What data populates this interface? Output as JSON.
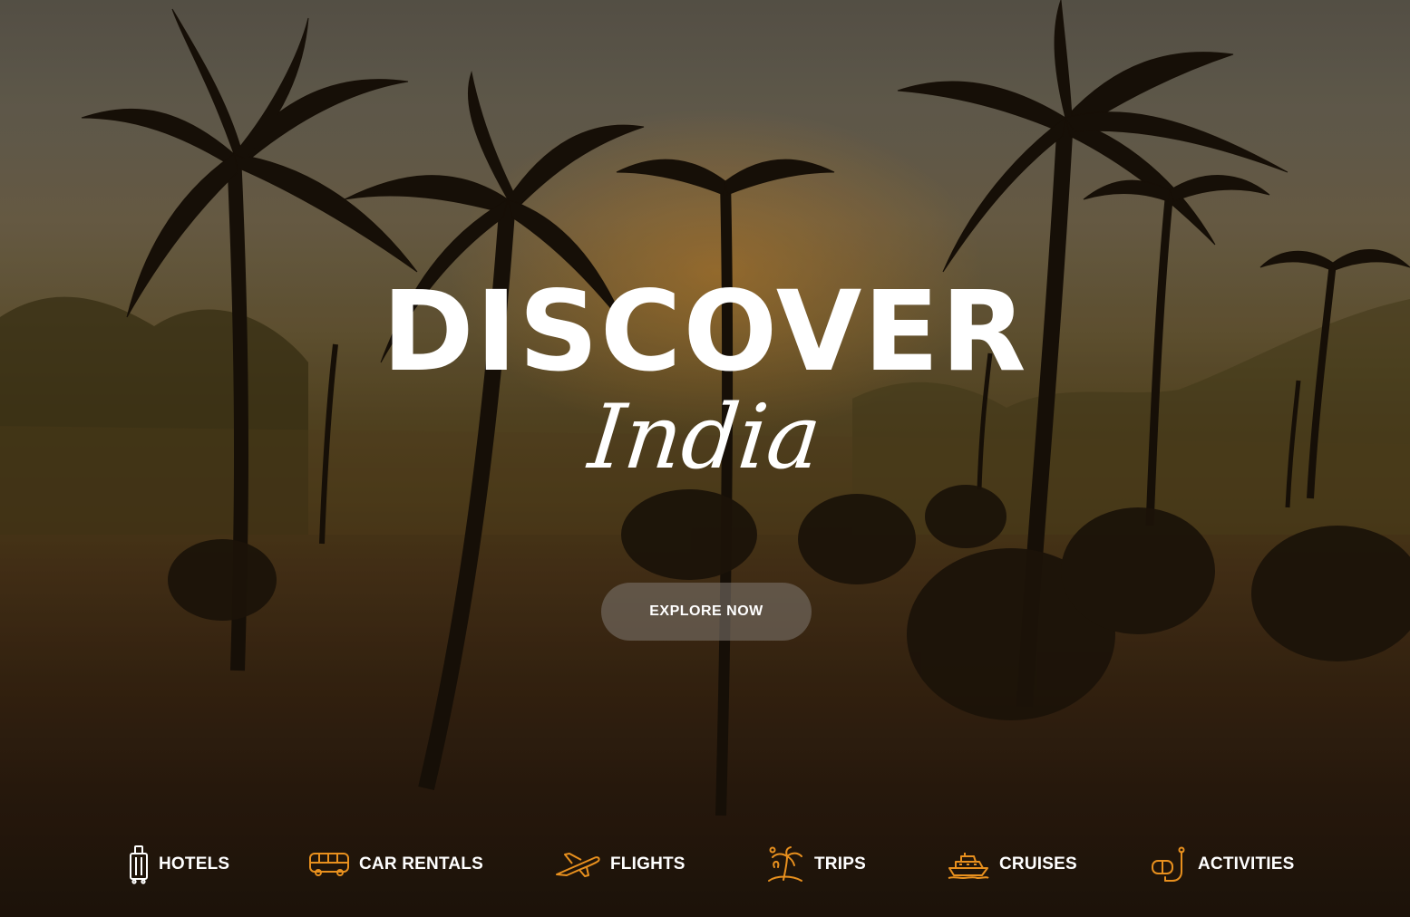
{
  "hero": {
    "title": "DISCOVER",
    "subtitle": "India",
    "cta_label": "EXPLORE NOW"
  },
  "categories": [
    {
      "label": "HOTELS",
      "icon": "luggage-icon",
      "icon_color": "#ffffff"
    },
    {
      "label": "CAR RENTALS",
      "icon": "bus-icon",
      "icon_color": "#e8901e"
    },
    {
      "label": "FLIGHTS",
      "icon": "airplane-icon",
      "icon_color": "#e8901e"
    },
    {
      "label": "TRIPS",
      "icon": "palm-island-icon",
      "icon_color": "#e8901e"
    },
    {
      "label": "CRUISES",
      "icon": "ship-icon",
      "icon_color": "#e8901e"
    },
    {
      "label": "ACTIVITIES",
      "icon": "snorkel-icon",
      "icon_color": "#e8901e"
    }
  ],
  "colors": {
    "accent": "#e8901e",
    "text": "#ffffff"
  }
}
